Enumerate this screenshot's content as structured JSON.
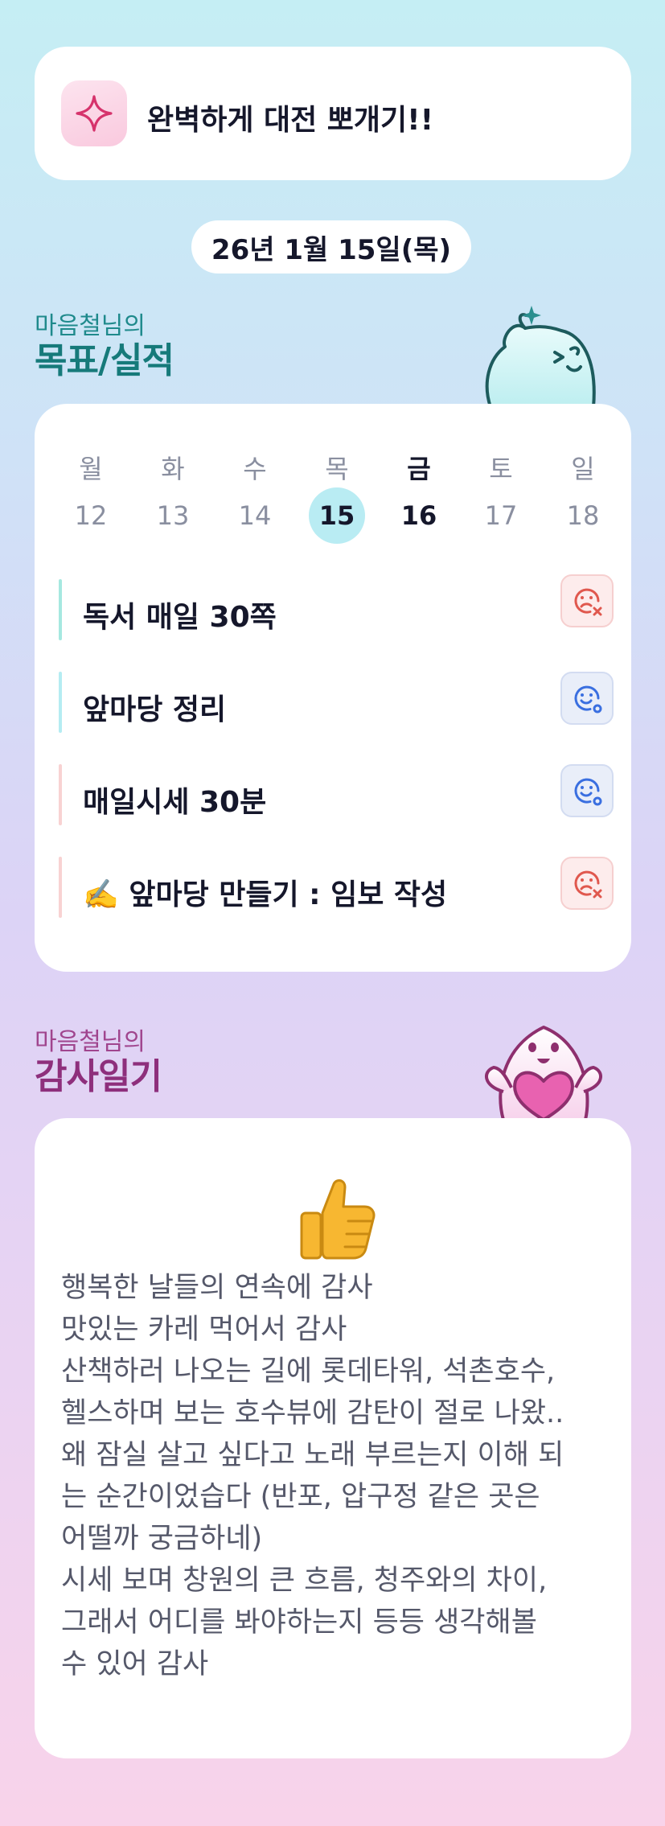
{
  "header": {
    "title": "완벽하게 대전 뽀개기!!",
    "icon": "sparkle-icon"
  },
  "date": "26년 1월 15일(목)",
  "goals_section": {
    "subtitle": "마음철님의",
    "title": "목표/실적"
  },
  "week": {
    "days": [
      {
        "name": "월",
        "num": "12"
      },
      {
        "name": "화",
        "num": "13"
      },
      {
        "name": "수",
        "num": "14"
      },
      {
        "name": "목",
        "num": "15"
      },
      {
        "name": "금",
        "num": "16"
      },
      {
        "name": "토",
        "num": "17"
      },
      {
        "name": "일",
        "num": "18"
      }
    ],
    "selected_index": 3,
    "active_index": 4
  },
  "goals": [
    {
      "text": "독서 매일 30쪽",
      "status": "fail",
      "bar_color": "#a6e8e0"
    },
    {
      "text": "앞마당 정리",
      "status": "ok",
      "bar_color": "#b5ecf2"
    },
    {
      "text": "매일시세 30분",
      "status": "ok",
      "bar_color": "#f8d2d2"
    },
    {
      "text": "✍️ 앞마당 만들기 : 임보 작성",
      "status": "fail",
      "bar_color": "#f8d2d2"
    }
  ],
  "gratitude_section": {
    "subtitle": "마음철님의",
    "title": "감사일기"
  },
  "gratitude": {
    "emoji": "thumbs-up-icon",
    "lines": [
      "행복한 날들의 연속에 감사",
      "맛있는 카레 먹어서 감사",
      "산책하러 나오는 길에 롯데타워, 석촌호수,",
      "헬스하며 보는 호수뷰에 감탄이 절로 나왔..",
      "왜 잠실 살고 싶다고 노래 부르는지 이해 되",
      "는 순간이었습다 (반포, 압구정 같은 곳은",
      "어떨까 궁금하네)",
      "시세 보며 창원의 큰 흐름, 청주와의 차이,",
      "그래서 어디를 봐야하는지 등등 생각해볼",
      "수 있어 감사"
    ]
  },
  "colors": {
    "teal": "#167a7a",
    "magenta": "#8e2f7c",
    "fail": "#e0584e",
    "ok": "#3a6fe0"
  }
}
